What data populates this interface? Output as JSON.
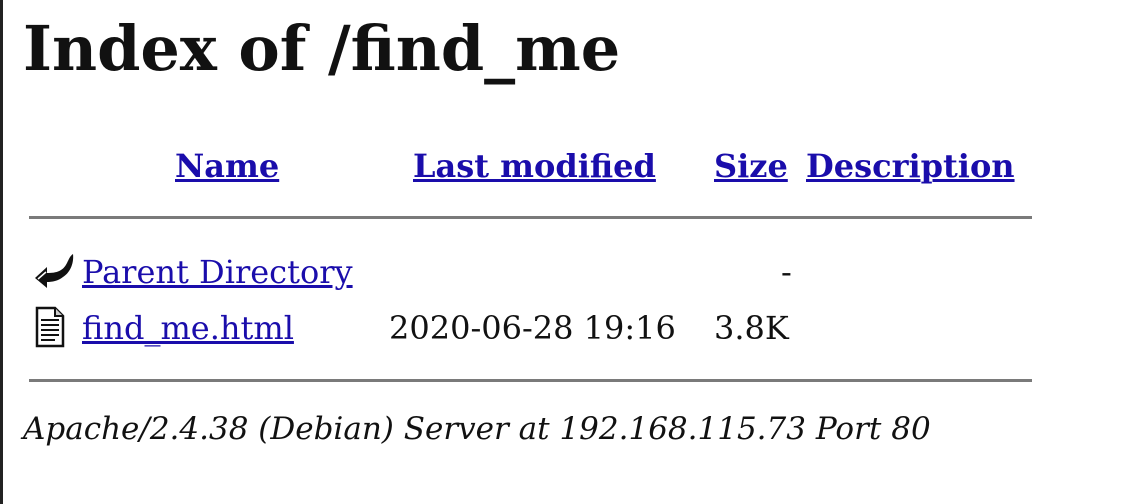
{
  "page": {
    "title": "Index of /find_me"
  },
  "table": {
    "headers": {
      "name": "Name",
      "last_modified": "Last modified",
      "size": "Size",
      "description": "Description"
    },
    "rows": [
      {
        "icon": "back-arrow-icon",
        "name": "Parent Directory",
        "last_modified": "",
        "size": "-",
        "description": ""
      },
      {
        "icon": "text-file-icon",
        "name": "find_me.html",
        "last_modified": "2020-06-28 19:16",
        "size": "3.8K",
        "description": ""
      }
    ]
  },
  "footer": {
    "server_signature": "Apache/2.4.38 (Debian) Server at 192.168.115.73 Port 80"
  }
}
